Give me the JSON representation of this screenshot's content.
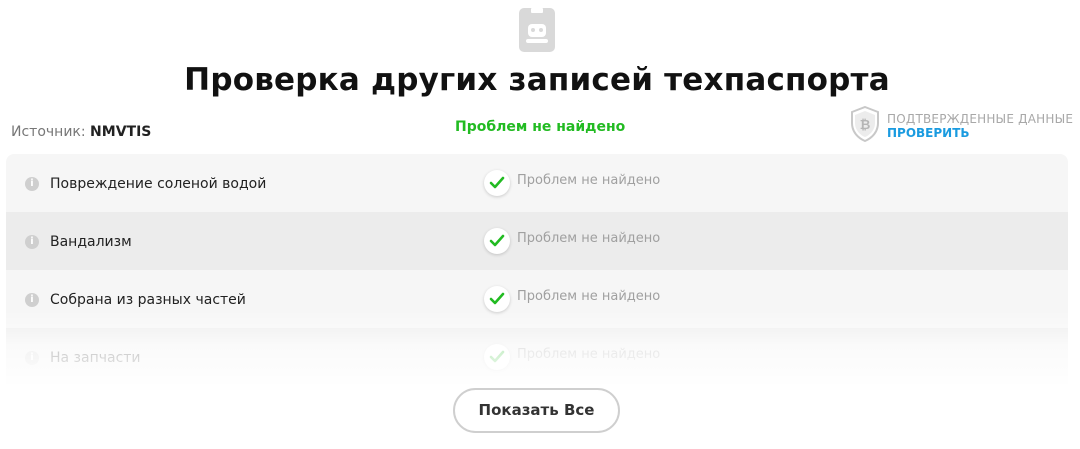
{
  "header": {
    "icon": "document-robot-icon",
    "title": "Проверка других записей техпаспорта"
  },
  "source": {
    "label": "Источник:",
    "value": "NMVTIS"
  },
  "summary_status": "Проблем не найдено",
  "verified": {
    "icon": "bitcoin-shield-icon",
    "text": "ПОДТВЕРЖДЕННЫЕ ДАННЫЕ",
    "link": "ПРОВЕРИТЬ"
  },
  "records": [
    {
      "label": "Повреждение соленой водой",
      "status": "Проблем не найдено"
    },
    {
      "label": "Вандализм",
      "status": "Проблем не найдено"
    },
    {
      "label": "Собрана из разных частей",
      "status": "Проблем не найдено"
    },
    {
      "label": "На запчасти",
      "status": "Проблем не найдено"
    }
  ],
  "show_all_label": "Показать Все",
  "colors": {
    "ok_green": "#22bb22",
    "link_blue": "#1a9be0",
    "row_light": "#f6f6f6",
    "row_dark": "#ececec"
  }
}
